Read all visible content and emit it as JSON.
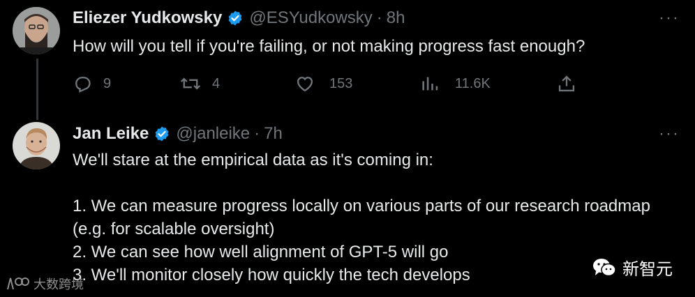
{
  "tweets": [
    {
      "name": "Eliezer Yudkowsky",
      "handle": "@ESYudkowsky",
      "time": "8h",
      "text": "How will you tell if you're failing, or not making progress fast enough?",
      "replies": "9",
      "retweets": "4",
      "likes": "153",
      "views": "11.6K"
    },
    {
      "name": "Jan Leike",
      "handle": "@janleike",
      "time": "7h",
      "text": "We'll stare at the empirical data as it's coming in:\n\n1. We can measure progress locally on various parts of our research roadmap (e.g. for scalable oversight)\n2. We can see how well alignment of GPT-5 will go\n3. We'll monitor closely how quickly the tech develops"
    }
  ],
  "separator": "·",
  "more_glyph": "···",
  "watermarks": {
    "left": "大数跨境",
    "right": "新智元"
  },
  "colors": {
    "background": "#000000",
    "text": "#e7e9ea",
    "muted": "#71767b",
    "verified": "#1d9bf0"
  },
  "icons": [
    "verified-badge-icon",
    "more-icon",
    "reply-icon",
    "retweet-icon",
    "like-icon",
    "views-icon",
    "share-icon"
  ]
}
